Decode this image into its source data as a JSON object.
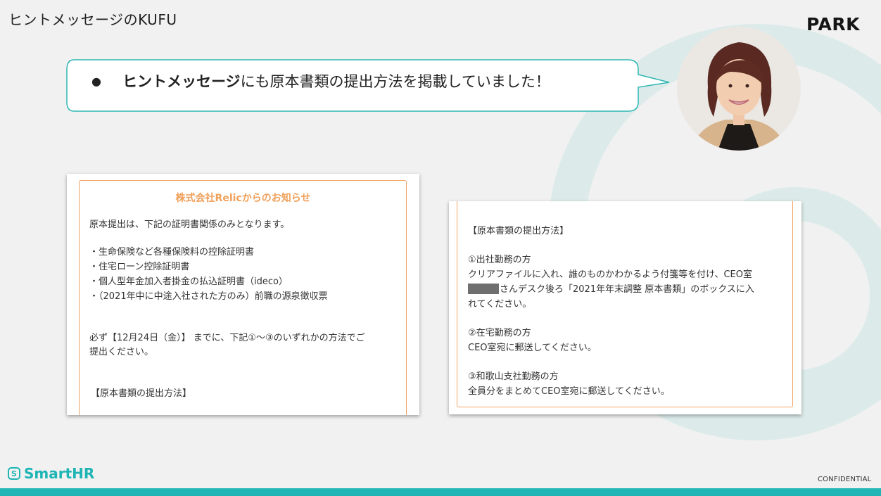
{
  "slide": {
    "title": "ヒントメッセージのKUFU",
    "park_logo": "PARK",
    "bubble": {
      "bullet": "●",
      "bold_text": "ヒントメッセージ",
      "text": "にも原本書類の提出方法を掲載していました！"
    }
  },
  "left_card": {
    "heading": "株式会社Relicからのお知らせ",
    "lines": [
      "原本提出は、下記の証明書関係のみとなります。",
      "・生命保険など各種保険料の控除証明書",
      "・住宅ローン控除証明書",
      "・個人型年金加入者掛金の払込証明書（ideco）",
      "・（2021年中に中途入社された方のみ）前職の源泉徴収票",
      "必ず【12月24日（金）】 までに、下記①〜③のいずれかの方法でご",
      "提出ください。",
      "【原本書類の提出方法】"
    ]
  },
  "right_card": {
    "lines": [
      "【原本書類の提出方法】",
      "①出社勤務の方",
      "クリアファイルに入れ、誰のものかわかるよう付箋等を付け、CEO室",
      "さんデスク後ろ「2021年年末調整 原本書類」のボックスに入",
      "れてください。",
      "②在宅勤務の方",
      "CEO室宛に郵送してください。",
      "③和歌山支社勤務の方",
      "全員分をまとめてCEO室宛に郵送してください。"
    ]
  },
  "footer": {
    "brand": "SmartHR",
    "brand_mark": "S",
    "confidential": "CONFIDENTIAL"
  },
  "colors": {
    "brand_teal": "#1fb5b5",
    "accent_orange": "#f0a05a",
    "decor_teal": "#dcebea"
  }
}
